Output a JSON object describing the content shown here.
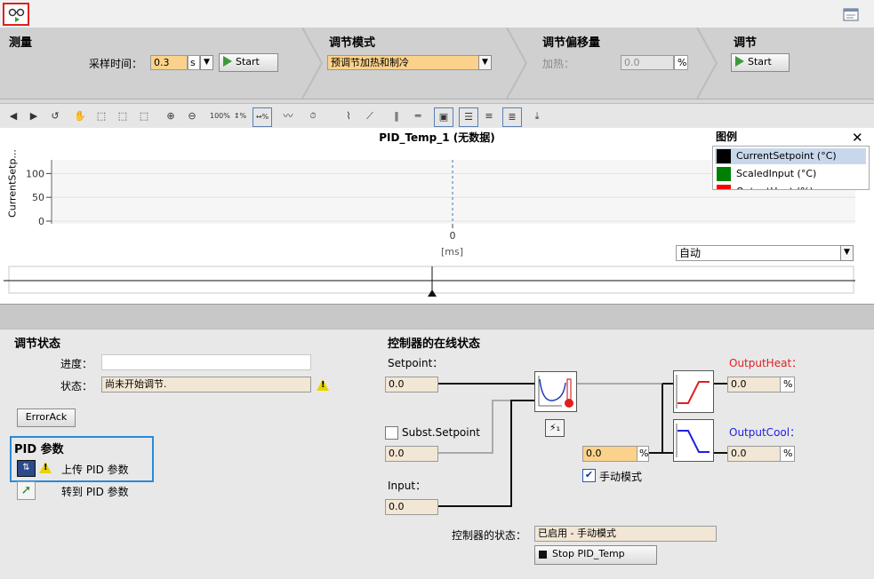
{
  "workflow": {
    "measure": {
      "title": "测量",
      "sample_label": "采样时间：",
      "sample_value": "0.3",
      "unit": "s",
      "start": "Start"
    },
    "mode": {
      "title": "调节模式",
      "value": "预调节加热和制冷"
    },
    "offset": {
      "title": "调节偏移量",
      "heat_label": "加热：",
      "value": "0.0",
      "unit": "%"
    },
    "tune": {
      "title": "调节",
      "start": "Start"
    }
  },
  "chart": {
    "title": "PID_Temp_1 (无数据)",
    "ylabel": "CurrentSetp...",
    "xunit": "[ms]",
    "mode_select": "自动",
    "legend_title": "图例",
    "legend_close": "✕"
  },
  "chart_data": {
    "type": "line",
    "title": "PID_Temp_1 (无数据)",
    "ylabel": "CurrentSetp...",
    "xlabel": "[ms]",
    "yticks": [
      100,
      50,
      0
    ],
    "xticks": [
      0
    ],
    "series": [
      {
        "name": "CurrentSetpoint (°C)",
        "color": "#000000",
        "values": []
      },
      {
        "name": "ScaledInput (°C)",
        "color": "#008000",
        "values": []
      },
      {
        "name": "OutputHeat (%)",
        "color": "#ff0000",
        "values": []
      }
    ]
  },
  "status": {
    "title": "调节状态",
    "progress_label": "进度：",
    "state_label": "状态：",
    "state_value": "尚未开始调节.",
    "errorack": "ErrorAck"
  },
  "pid_params": {
    "title": "PID 参数",
    "upload": "上传 PID 参数",
    "goto": "转到 PID 参数"
  },
  "online": {
    "title": "控制器的在线状态",
    "setpoint_label": "Setpoint：",
    "setpoint_value": "0.0",
    "subst_label": "Subst.Setpoint",
    "subst_value": "0.0",
    "input_label": "Input：",
    "input_value": "0.0",
    "manual_value": "0.0",
    "manual_unit": "%",
    "manual_mode": "手动模式",
    "heat_label": "OutputHeat：",
    "heat_value": "0.0",
    "heat_unit": "%",
    "cool_label": "OutputCool：",
    "cool_value": "0.0",
    "cool_unit": "%",
    "ctrl_state_label": "控制器的状态：",
    "ctrl_state_value": "已启用 - 手动模式",
    "stop_button": "Stop PID_Temp"
  },
  "colors": {
    "accent_field": "#fbd28c",
    "heat": "#e02020",
    "cool": "#2020e0"
  }
}
